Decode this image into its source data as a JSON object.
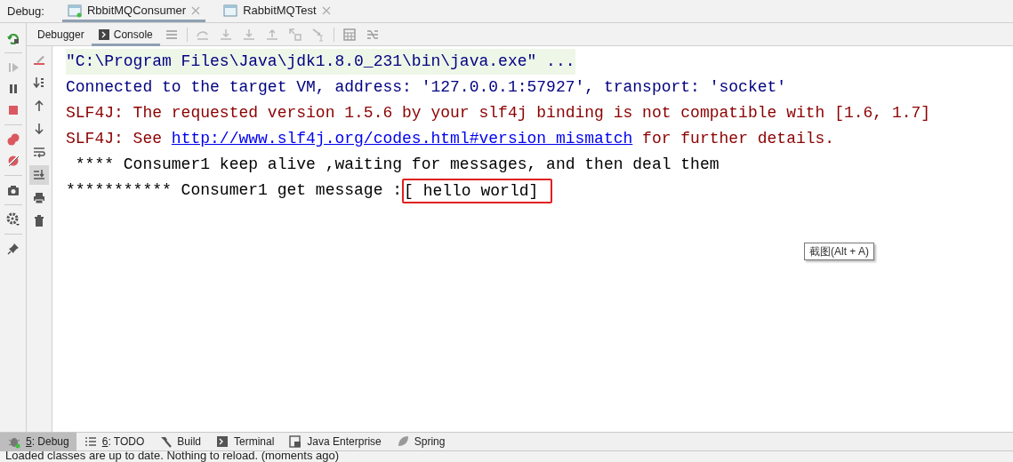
{
  "debug_label": "Debug:",
  "session_tabs": [
    {
      "label": "RbbitMQConsumer",
      "selected": true,
      "running": true
    },
    {
      "label": "RabbitMQTest",
      "selected": false,
      "running": false
    }
  ],
  "toolbar_tabs": [
    {
      "label": "Debugger",
      "selected": false
    },
    {
      "label": "Console",
      "selected": true
    }
  ],
  "scroll_to_end_on": true,
  "console_lines": [
    {
      "kind": "command",
      "text": "\"C:\\Program Files\\Java\\jdk1.8.0_231\\bin\\java.exe\" ..."
    },
    {
      "kind": "info",
      "text": "Connected to the target VM, address: '127.0.0.1:57927', transport: 'socket'"
    },
    {
      "kind": "error",
      "text": "SLF4J: The requested version 1.5.6 by your slf4j binding is not compatible with [1.6, 1.7]"
    },
    {
      "kind": "error",
      "text": "SLF4J: See ",
      "link": "http://www.slf4j.org/codes.html#version_mismatch",
      "after": " for further details."
    },
    {
      "kind": "plain",
      "text": " **** Consumer1 keep alive ,waiting for messages, and then deal them"
    },
    {
      "kind": "plain",
      "text": "*********** Consumer1 get message :",
      "highlight": "[ hello world]"
    }
  ],
  "tooltip": "截图(Alt + A)",
  "tool_windows": [
    {
      "kind": "bug",
      "number": "5",
      "label": ": Debug",
      "selected": true
    },
    {
      "kind": "list",
      "number": "6",
      "label": ": TODO",
      "selected": false
    },
    {
      "kind": "hammer",
      "label": "Build",
      "selected": false
    },
    {
      "kind": "terminal",
      "label": "Terminal",
      "selected": false
    },
    {
      "kind": "enterprise",
      "label": "Java Enterprise",
      "selected": false
    },
    {
      "kind": "leaf",
      "label": "Spring",
      "selected": false
    }
  ],
  "status_bar": "Loaded classes are up to date. Nothing to reload. (moments ago)"
}
